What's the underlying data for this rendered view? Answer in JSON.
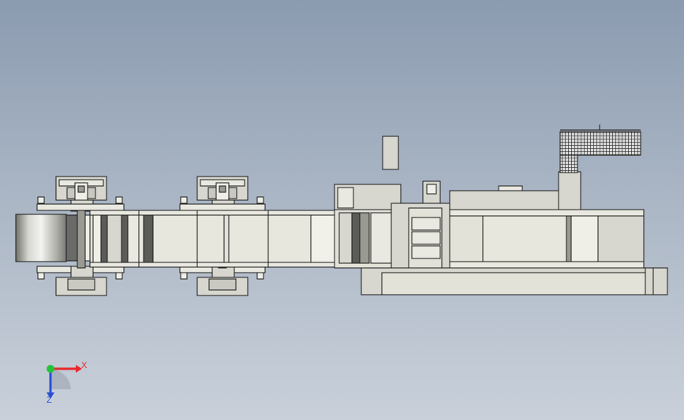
{
  "viewport": {
    "background_top": "#8b9bb0",
    "background_bottom": "#c9d0da"
  },
  "colors": {
    "frame": "#d7d7cf",
    "frame_light": "#e9e9e1",
    "frame_dark": "#9a9a92",
    "belt": "#e2e2d8",
    "roller_dark": "#5b5b58",
    "outline": "#1b1b1b",
    "mesh": "#2b2b2b"
  },
  "triad": {
    "x_label": "X",
    "z_label": "Z",
    "x_color": "#e8282c",
    "y_color": "#22c43a",
    "z_color": "#2a4fd6"
  },
  "components": [
    "raw-material-coil",
    "feed-roller-stand-1",
    "feed-roller-stand-2",
    "roll-forming-conveyor",
    "cutting-unit",
    "control-box",
    "main-machine-body",
    "mesh-guard-panel",
    "base-frame"
  ]
}
